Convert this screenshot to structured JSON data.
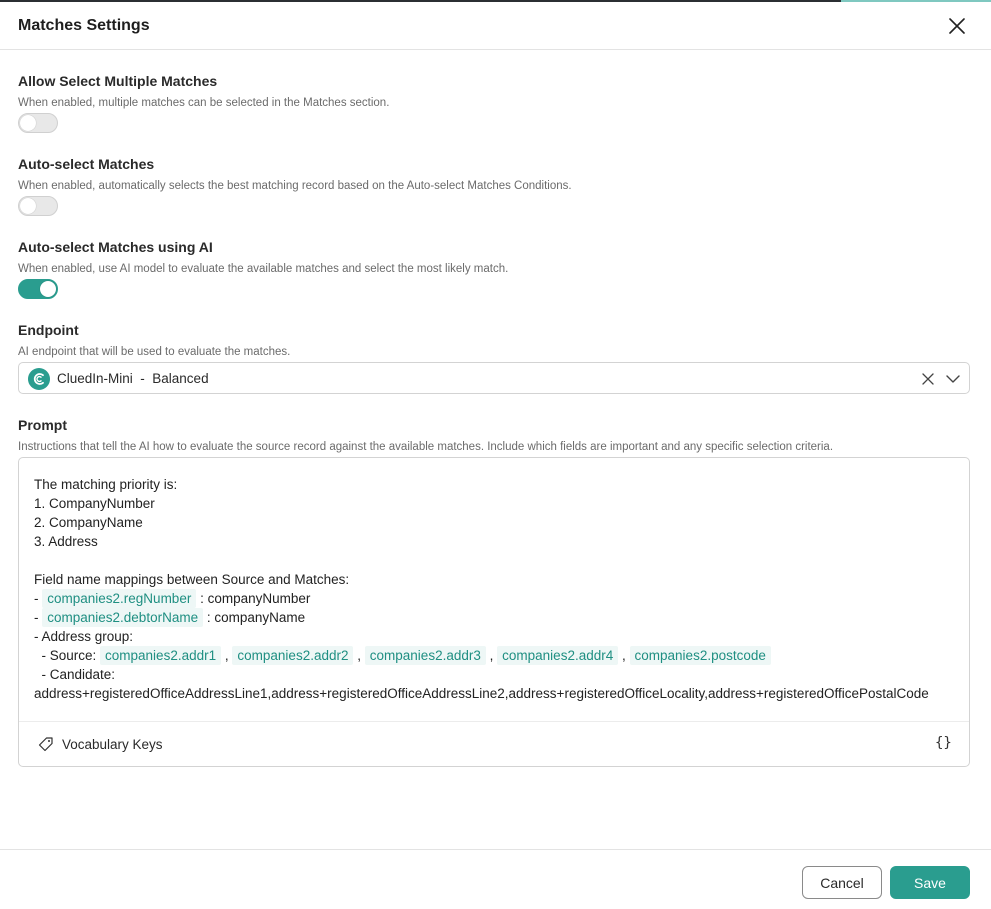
{
  "dialog": {
    "title": "Matches Settings"
  },
  "settings": {
    "allow_multiple": {
      "label": "Allow Select Multiple Matches",
      "help": "When enabled, multiple matches can be selected in the Matches section.",
      "enabled": false
    },
    "auto_select": {
      "label": "Auto-select Matches",
      "help": "When enabled, automatically selects the best matching record based on the Auto-select Matches Conditions.",
      "enabled": false
    },
    "auto_select_ai": {
      "label": "Auto-select Matches using AI",
      "help": "When enabled, use AI model to evaluate the available matches and select the most likely match.",
      "enabled": true
    }
  },
  "endpoint": {
    "label": "Endpoint",
    "help": "AI endpoint that will be used to evaluate the matches.",
    "selected": "CluedIn-Mini  -  Balanced"
  },
  "prompt": {
    "label": "Prompt",
    "help": "Instructions that tell the AI how to evaluate the source record against the available matches. Include which fields are important and any specific selection criteria.",
    "lines": {
      "l1": "The matching priority is:",
      "l2": "1. CompanyNumber",
      "l3": "2. CompanyName",
      "l4": "3. Address",
      "l6": "Field name mappings between Source and Matches:",
      "l7_prefix": "- ",
      "l7_chip": "companies2.regNumber",
      "l7_suffix": " : companyNumber",
      "l8_prefix": "- ",
      "l8_chip": "companies2.debtorName",
      "l8_suffix": " : companyName",
      "l9": "- Address group:",
      "l10_prefix": "  - Source: ",
      "l10_chips": [
        "companies2.addr1",
        "companies2.addr2",
        "companies2.addr3",
        "companies2.addr4",
        "companies2.postcode"
      ],
      "l10_sep": ",",
      "l11": "  - Candidate:",
      "l12": "address+registeredOfficeAddressLine1,address+registeredOfficeAddressLine2,address+registeredOfficeLocality,address+registeredOfficePostalCode"
    },
    "footer": {
      "vocab_label": "Vocabulary Keys",
      "braces": "{}"
    }
  },
  "actions": {
    "cancel": "Cancel",
    "save": "Save"
  },
  "colors": {
    "accent": "#2a9d8f",
    "chip_bg": "#eef7f6",
    "chip_text": "#1f8f82"
  }
}
